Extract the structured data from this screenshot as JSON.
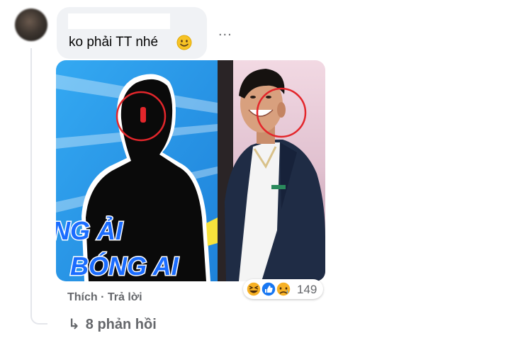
{
  "comment": {
    "text": "ko phải TT nhé",
    "emoji": "slightly-smiling-face",
    "more_options": "..."
  },
  "photo": {
    "caption_line1": "NG ẢI",
    "caption_line2": "BÓNG AI"
  },
  "actions": {
    "like": "Thích",
    "separator": " · ",
    "reply": "Trả lời"
  },
  "reactions": {
    "icons": [
      "haha-icon",
      "like-icon",
      "sad-icon"
    ],
    "count": "149"
  },
  "replies": {
    "arrow": "↳",
    "label": "8 phản hồi"
  },
  "colors": {
    "bubble": "#f0f2f5",
    "muted_text": "#65676b",
    "photo_blue": "#2f9bea",
    "caption_blue": "#1a6cff",
    "circle_red": "#e3262b",
    "like_blue": "#1877f2",
    "reaction_yellow": "#f7b125"
  }
}
